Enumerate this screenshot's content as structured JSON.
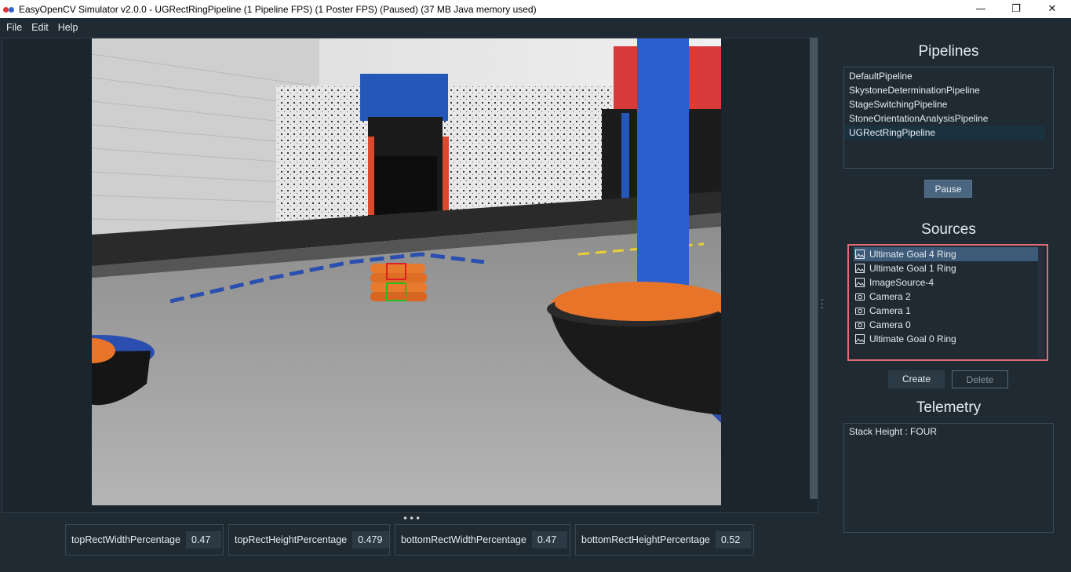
{
  "window": {
    "title": "EasyOpenCV Simulator v2.0.0 - UGRectRingPipeline (1 Pipeline FPS) (1 Poster FPS) (Paused) (37 MB Java memory used)",
    "minimize": "—",
    "maximize": "❐",
    "close": "✕"
  },
  "menu": {
    "file": "File",
    "edit": "Edit",
    "help": "Help"
  },
  "pipelines": {
    "title": "Pipelines",
    "items": [
      "DefaultPipeline",
      "SkystoneDeterminationPipeline",
      "StageSwitchingPipeline",
      "StoneOrientationAnalysisPipeline",
      "UGRectRingPipeline"
    ],
    "selected": "UGRectRingPipeline",
    "pause_label": "Pause"
  },
  "sources": {
    "title": "Sources",
    "items": [
      {
        "label": "Ultimate Goal 4 Ring",
        "icon": "image-icon"
      },
      {
        "label": "Ultimate Goal 1 Ring",
        "icon": "image-icon"
      },
      {
        "label": "ImageSource-4",
        "icon": "image-icon"
      },
      {
        "label": "Camera 2",
        "icon": "camera-icon"
      },
      {
        "label": "Camera 1",
        "icon": "camera-icon"
      },
      {
        "label": "Camera 0",
        "icon": "camera-icon"
      },
      {
        "label": "Ultimate Goal 0 Ring",
        "icon": "image-icon"
      }
    ],
    "selected": "Ultimate Goal 4 Ring",
    "create_label": "Create",
    "delete_label": "Delete",
    "border_color": "#e06c75"
  },
  "telemetry": {
    "title": "Telemetry",
    "lines": [
      "Stack Height : FOUR"
    ]
  },
  "tuners": [
    {
      "label": "topRectWidthPercentage",
      "value": "0.47"
    },
    {
      "label": "topRectHeightPercentage",
      "value": "0.479"
    },
    {
      "label": "bottomRectWidthPercentage",
      "value": "0.47"
    },
    {
      "label": "bottomRectHeightPercentage",
      "value": "0.52"
    }
  ],
  "colors": {
    "background": "#1f2a33",
    "selection": "#3d5a78",
    "accent_button": "#4a6580"
  }
}
